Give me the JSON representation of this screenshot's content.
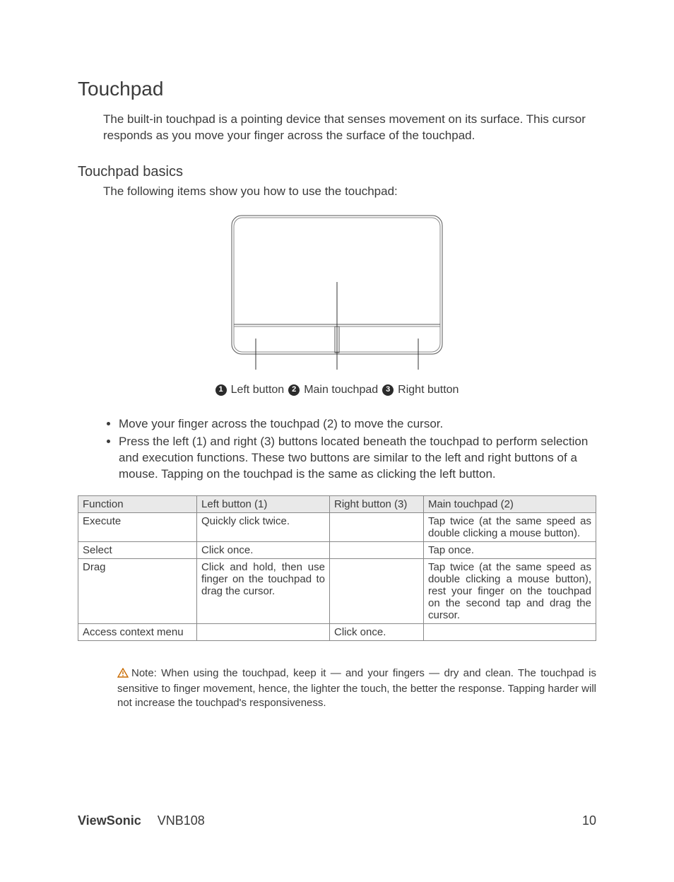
{
  "heading": "Touchpad",
  "intro": "The built-in touchpad is a pointing device that senses movement on its surface. This cursor responds as you move your finger across the surface of the touchpad.",
  "subheading": "Touchpad basics",
  "sub_intro": "The following items show you how to use the touchpad:",
  "diagram": {
    "label1": "Left button",
    "label2": "Main touchpad",
    "label3": "Right button"
  },
  "bullets": {
    "b1": "Move your finger across the touchpad (2) to move the cursor.",
    "b2": "Press the left (1) and right (3) buttons located beneath the touchpad to perform selection and execution functions. These two buttons are similar to the left and right buttons of a mouse. Tapping on the touchpad is the same as clicking the left button."
  },
  "table": {
    "head": {
      "c0": "Function",
      "c1": "Left button (1)",
      "c2": "Right button (3)",
      "c3": "Main touchpad (2)"
    },
    "rows": {
      "r0": {
        "c0": "Execute",
        "c1": "Quickly click twice.",
        "c2": "",
        "c3": "Tap twice (at the same speed as double clicking a mouse button)."
      },
      "r1": {
        "c0": "Select",
        "c1": "Click once.",
        "c2": "",
        "c3": "Tap once."
      },
      "r2": {
        "c0": "Drag",
        "c1": "Click and hold, then use finger on the touchpad to drag the cursor.",
        "c2": "",
        "c3": "Tap twice (at the same speed as double clicking a mouse button), rest your finger on the touchpad on the second tap and drag the cursor."
      },
      "r3": {
        "c0": "Access context menu",
        "c1": "",
        "c2": "Click once.",
        "c3": ""
      }
    }
  },
  "note": "Note: When using the touchpad, keep it — and your fingers — dry and clean. The touchpad is sensitive to finger movement, hence, the lighter the touch, the better the response. Tapping harder will not increase the touchpad's responsiveness.",
  "footer": {
    "brand": "ViewSonic",
    "model": "VNB108",
    "page": "10"
  }
}
